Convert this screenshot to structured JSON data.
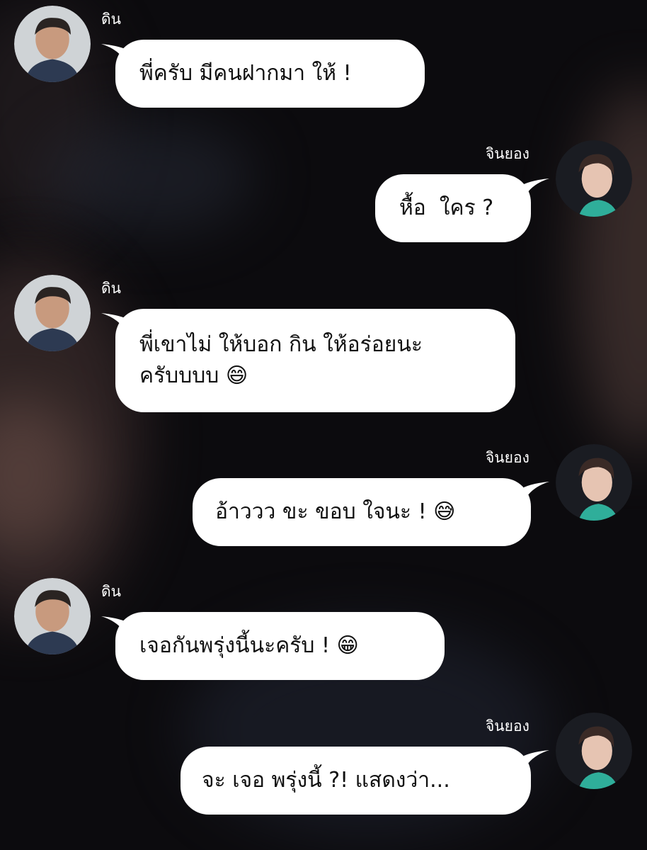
{
  "contacts": {
    "din": {
      "name": "ดิน",
      "avatar": "din-avatar"
    },
    "jinyoung": {
      "name": "จินยอง",
      "avatar": "jinyoung-avatar"
    }
  },
  "messages": [
    {
      "sender": "din",
      "side": "left",
      "text": "พี่ครับ มีคนฝากมา ให้ !"
    },
    {
      "sender": "jinyoung",
      "side": "right",
      "text": "หื้อ  ใคร ?"
    },
    {
      "sender": "din",
      "side": "left",
      "text": "พี่เขาไม่ ให้บอก กิน ให้อร่อยนะ\nครับบบบ 😄"
    },
    {
      "sender": "jinyoung",
      "side": "right",
      "text": "อ้าววว ขะ ขอบ ใจนะ ! 😅"
    },
    {
      "sender": "din",
      "side": "left",
      "text": "เจอกันพรุ่งนี้นะครับ ! 😁"
    },
    {
      "sender": "jinyoung",
      "side": "right",
      "text": "จะ เจอ พรุ่งนี้ ?! แสดงว่า..."
    }
  ],
  "colors": {
    "bubble": "#ffffff",
    "text": "#111111",
    "name": "#ffffff",
    "background": "#0c0b0e"
  }
}
